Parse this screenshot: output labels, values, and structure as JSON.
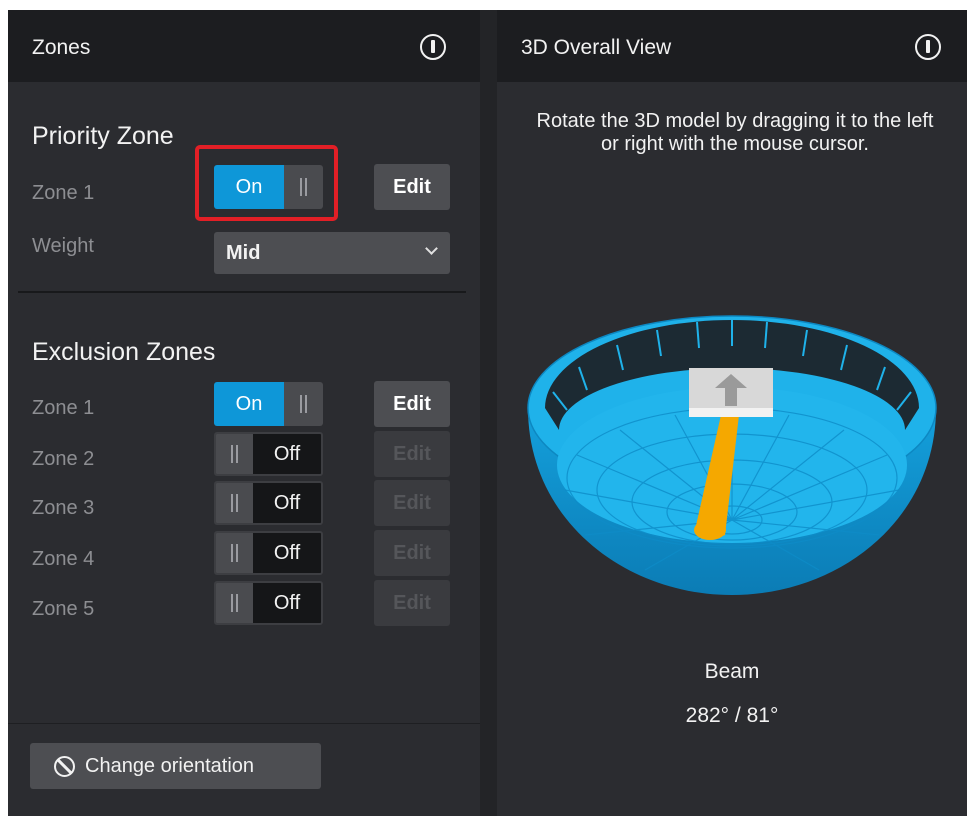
{
  "zones_panel": {
    "title": "Zones",
    "priority_zone": {
      "title": "Priority Zone",
      "zone": {
        "label": "Zone 1",
        "toggle": "On",
        "edit": "Edit"
      },
      "weight": {
        "label": "Weight",
        "value": "Mid"
      }
    },
    "exclusion_zones": {
      "title": "Exclusion Zones",
      "zones": [
        {
          "label": "Zone 1",
          "toggle": "On",
          "edit": "Edit",
          "enabled": true
        },
        {
          "label": "Zone 2",
          "toggle": "Off",
          "edit": "Edit",
          "enabled": false
        },
        {
          "label": "Zone 3",
          "toggle": "Off",
          "edit": "Edit",
          "enabled": false
        },
        {
          "label": "Zone 4",
          "toggle": "Off",
          "edit": "Edit",
          "enabled": false
        },
        {
          "label": "Zone 5",
          "toggle": "Off",
          "edit": "Edit",
          "enabled": false
        }
      ]
    },
    "change_orientation_label": "Change orientation"
  },
  "view_panel": {
    "title": "3D Overall View",
    "instructions": "Rotate the 3D model by dragging it to the left or right with the mouse cursor.",
    "beam_label": "Beam",
    "beam_value": "282° / 81°"
  },
  "icons": [
    "info-icon",
    "ban-icon",
    "chevron-down-icon",
    "up-arrow-icon"
  ],
  "colors": {
    "accent": "#0e97d8",
    "panel_bg": "#2b2c30",
    "header_bg": "#1c1d20",
    "highlight": "#e21f26",
    "bowl": "#1aa7e0",
    "beam": "#f5a800"
  }
}
